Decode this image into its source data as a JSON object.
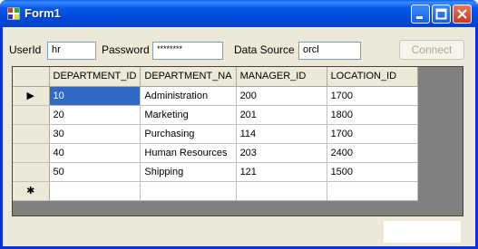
{
  "window": {
    "title": "Form1"
  },
  "form": {
    "userid_label": "UserId",
    "userid_value": "hr",
    "password_label": "Password",
    "password_value": "********",
    "datasource_label": "Data Source",
    "datasource_value": "orcl",
    "connect_label": "Connect"
  },
  "grid": {
    "columns": [
      "DEPARTMENT_ID",
      "DEPARTMENT_NA",
      "MANAGER_ID",
      "LOCATION_ID"
    ],
    "rows": [
      [
        "10",
        "Administration",
        "200",
        "1700"
      ],
      [
        "20",
        "Marketing",
        "201",
        "1800"
      ],
      [
        "30",
        "Purchasing",
        "114",
        "1700"
      ],
      [
        "40",
        "Human Resources",
        "203",
        "2400"
      ],
      [
        "50",
        "Shipping",
        "121",
        "1500"
      ]
    ],
    "current_row_marker": "▶",
    "new_row_marker": "✱"
  }
}
